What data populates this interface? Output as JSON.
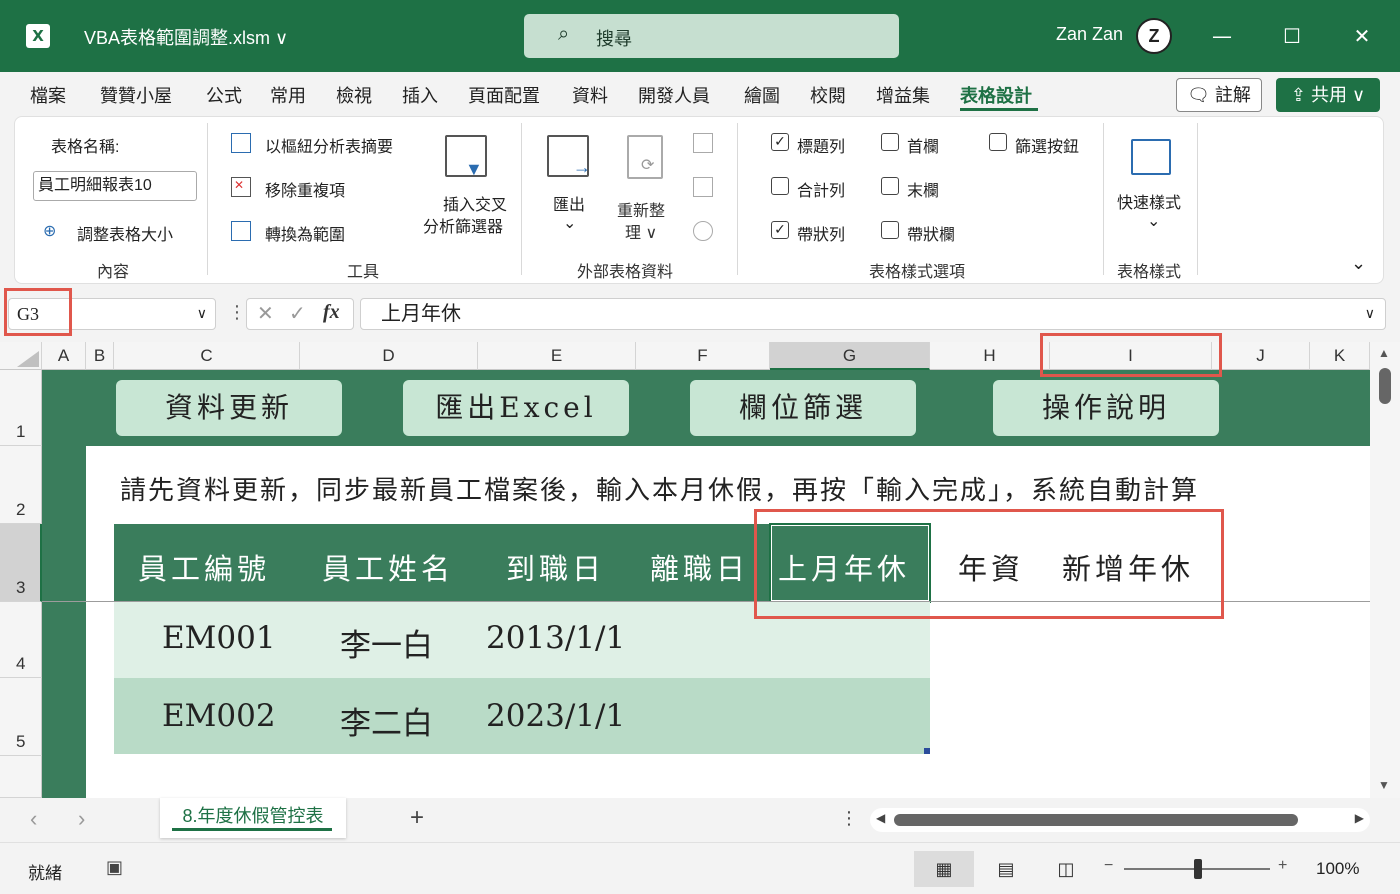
{
  "titlebar": {
    "logo": "X",
    "file_title": "VBA表格範圍調整.xlsm ∨",
    "search_placeholder": "搜尋",
    "user_name": "Zan Zan",
    "avatar_letter": "Z",
    "minimize": "—",
    "maximize": "☐",
    "close": "✕"
  },
  "menu": {
    "tabs": [
      "檔案",
      "贊贊小屋",
      "公式",
      "常用",
      "檢視",
      "插入",
      "頁面配置",
      "資料",
      "開發人員",
      "繪圖",
      "校閱",
      "增益集",
      "表格設計"
    ],
    "active_tab": "表格設計",
    "comment_label": "註解",
    "share_label": "共用 ∨"
  },
  "ribbon": {
    "props": {
      "table_name_label": "表格名稱:",
      "table_name_value": "員工明細報表10",
      "resize_label": "調整表格大小",
      "group_label": "內容"
    },
    "tools": {
      "pivot_label": "以樞紐分析表摘要",
      "remove_dup_label": "移除重複項",
      "convert_label": "轉換為範圍",
      "slicer_label_1": "插入交叉",
      "slicer_label_2": "分析篩選器",
      "group_label": "工具"
    },
    "external": {
      "export_label": "匯出",
      "refresh_label_1": "重新整",
      "refresh_label_2": "理 ∨",
      "group_label": "外部表格資料"
    },
    "style_options": {
      "header_row": "標題列",
      "first_column": "首欄",
      "filter_button": "篩選按鈕",
      "total_row": "合計列",
      "last_column": "末欄",
      "banded_rows": "帶狀列",
      "banded_columns": "帶狀欄",
      "group_label": "表格樣式選項"
    },
    "styles": {
      "quick_styles_label": "快速樣式",
      "group_label": "表格樣式"
    }
  },
  "formula_bar": {
    "name_box": "G3",
    "cancel": "✕",
    "enter": "✓",
    "fx": "fx",
    "formula": "上月年休"
  },
  "grid": {
    "columns": [
      "A",
      "B",
      "C",
      "D",
      "E",
      "F",
      "G",
      "H",
      "I",
      "J",
      "K"
    ],
    "rows": [
      "1",
      "2",
      "3",
      "4",
      "5"
    ],
    "buttons": [
      "資料更新",
      "匯出Excel",
      "欄位篩選",
      "操作說明"
    ],
    "instruction": "請先資料更新，同步最新員工檔案後，輸入本月休假，再按「輸入完成」，系統自動計算",
    "headers": [
      "員工編號",
      "員工姓名",
      "到職日",
      "離職日",
      "上月年休",
      "年資",
      "新增年休"
    ],
    "data_rows": [
      [
        "EM001",
        "李一白",
        "2013/1/1"
      ],
      [
        "EM002",
        "李二白",
        "2023/1/1"
      ]
    ]
  },
  "sheets": {
    "active_sheet": "8.年度休假管控表",
    "add_sheet": "+"
  },
  "status": {
    "ready": "就緒",
    "zoom": "100%"
  }
}
